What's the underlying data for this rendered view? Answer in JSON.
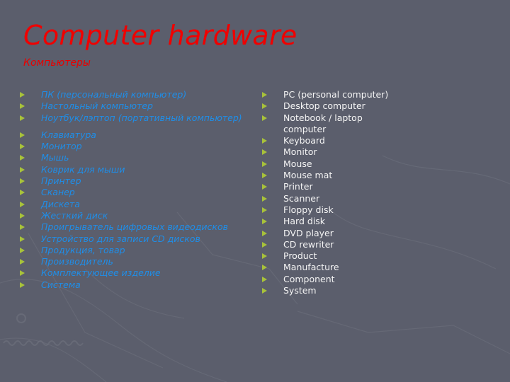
{
  "slide": {
    "title": "Computer hardware",
    "subtitle": "Компьютеры",
    "colors": {
      "background": "#5b5e6c",
      "title": "#f00000",
      "russian_text": "#1f8ee8",
      "english_text": "#f4f4f4",
      "bullet": "#a8c23a"
    },
    "russian_terms": [
      "ПК (персональный компьютер)",
      "Настольный компьютер",
      "Ноутбук/лэптоп (портативный компьютер)",
      "Клавиатура",
      "Монитор",
      "Мышь",
      "Коврик для мыши",
      "Принтер",
      "Сканер",
      "Дискета",
      "Жесткий диск",
      "Проигрыватель цифровых видеодисков",
      "Устройство для записи CD дисков",
      "Продукция, товар",
      "Производитель",
      "Комплектующее изделие",
      "Система"
    ],
    "english_terms": [
      "PC (personal computer)",
      "Desktop computer",
      "Notebook / laptop computer",
      "Keyboard",
      "Monitor",
      "Mouse",
      "Mouse mat",
      "Printer",
      "Scanner",
      "Floppy disk",
      "Hard disk",
      "DVD player",
      "CD rewriter",
      "Product",
      "Manufacture",
      "Component",
      "System"
    ],
    "bullet_icon": "triangle-bullet"
  }
}
